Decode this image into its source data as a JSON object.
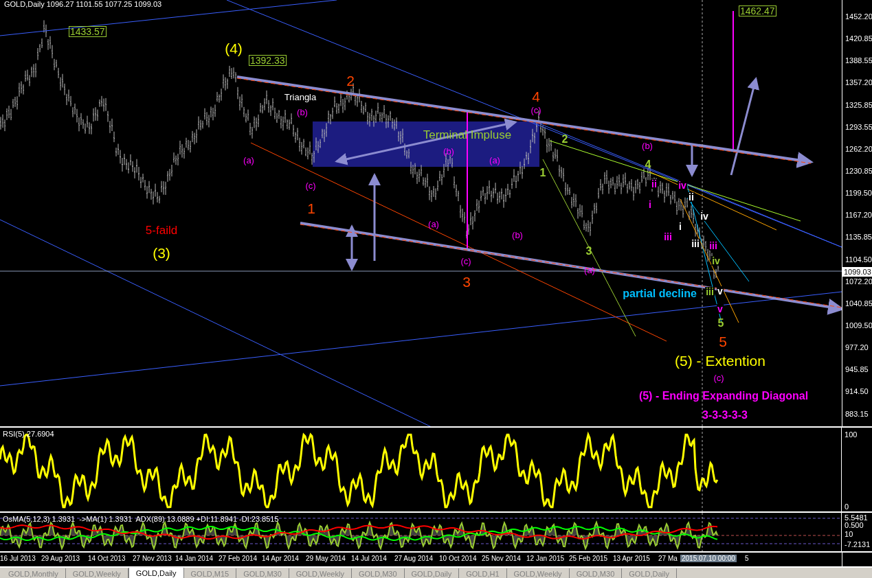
{
  "chart": {
    "header": "GOLD,Daily  1096.27 1101.55 1077.25 1099.03",
    "annotations": [
      {
        "kind": "price_box",
        "text": "1433.57",
        "color": "#9acd32"
      },
      {
        "kind": "price_box",
        "text": "1392.33",
        "color": "#9acd32"
      },
      {
        "kind": "price_box",
        "text": "1462.47",
        "color": "#9acd32"
      },
      {
        "kind": "big",
        "text": "(4)",
        "color": "#ffff00"
      },
      {
        "kind": "small",
        "text": "Triangla",
        "color": "#ffffff"
      },
      {
        "kind": "big",
        "text": "2",
        "color": "#ff4500"
      },
      {
        "kind": "big",
        "text": "4",
        "color": "#ff4500"
      },
      {
        "kind": "small",
        "text": "(c)",
        "color": "#ff00ff"
      },
      {
        "kind": "small",
        "text": "(b)",
        "color": "#ff00ff"
      },
      {
        "kind": "small",
        "text": "(a)",
        "color": "#ff00ff"
      },
      {
        "kind": "small",
        "text": "(c)",
        "color": "#ff00ff"
      },
      {
        "kind": "medium",
        "text": "Terminal Impluse",
        "color": "#9acd32"
      },
      {
        "kind": "small",
        "text": "(b)",
        "color": "#ff00ff"
      },
      {
        "kind": "small",
        "text": "(a)",
        "color": "#ff00ff"
      },
      {
        "kind": "bold",
        "text": "2",
        "color": "#9acd32"
      },
      {
        "kind": "bold",
        "text": "1",
        "color": "#9acd32"
      },
      {
        "kind": "small",
        "text": "(b)",
        "color": "#ff00ff"
      },
      {
        "kind": "bold",
        "text": "4",
        "color": "#9acd32"
      },
      {
        "kind": "tiny",
        "text": "ii",
        "color": "#ff00ff"
      },
      {
        "kind": "tiny",
        "text": "iv",
        "color": "#ff00ff"
      },
      {
        "kind": "tiny",
        "text": "ii",
        "color": "#ffffff"
      },
      {
        "kind": "tiny",
        "text": "i",
        "color": "#ff00ff"
      },
      {
        "kind": "tiny",
        "text": "i",
        "color": "#ffffff"
      },
      {
        "kind": "tiny",
        "text": "iii",
        "color": "#ff00ff"
      },
      {
        "kind": "tiny",
        "text": "iv",
        "color": "#ffffff"
      },
      {
        "kind": "tiny",
        "text": "iii",
        "color": "#ffffff"
      },
      {
        "kind": "tiny",
        "text": "iii",
        "color": "#ff00ff"
      },
      {
        "kind": "tiny",
        "text": "iv",
        "color": "#9acd32"
      },
      {
        "kind": "tiny",
        "text": "iii",
        "color": "#9acd32"
      },
      {
        "kind": "tiny",
        "text": "v",
        "color": "#ffffff"
      },
      {
        "kind": "tiny",
        "text": "v",
        "color": "#ff00ff"
      },
      {
        "kind": "medium",
        "text": "5-faild",
        "color": "#ff0000"
      },
      {
        "kind": "big",
        "text": "(3)",
        "color": "#ffff00"
      },
      {
        "kind": "big",
        "text": "1",
        "color": "#ff4500"
      },
      {
        "kind": "small",
        "text": "(a)",
        "color": "#ff00ff"
      },
      {
        "kind": "small",
        "text": "(b)",
        "color": "#ff00ff"
      },
      {
        "kind": "small",
        "text": "(c)",
        "color": "#ff00ff"
      },
      {
        "kind": "big",
        "text": "3",
        "color": "#ff4500"
      },
      {
        "kind": "bold",
        "text": "3",
        "color": "#9acd32"
      },
      {
        "kind": "small",
        "text": "(a)",
        "color": "#ff00ff"
      },
      {
        "kind": "bold",
        "text": "partial decline",
        "color": "#00bfff"
      },
      {
        "kind": "bold",
        "text": "5",
        "color": "#9acd32"
      },
      {
        "kind": "big",
        "text": "5",
        "color": "#ff4500"
      },
      {
        "kind": "big",
        "text": "(5) -  Extention",
        "color": "#ffff00"
      },
      {
        "kind": "small",
        "text": "(c)",
        "color": "#ff00ff"
      },
      {
        "kind": "bold",
        "text": "(5) - Ending Expanding Diagonal",
        "color": "#ff00ff"
      },
      {
        "kind": "bold",
        "text": "3-3-3-3-3",
        "color": "#ff00ff"
      }
    ],
    "price_axis": [
      "1452.20",
      "1420.85",
      "1388.55",
      "1357.20",
      "1325.85",
      "1293.55",
      "1262.20",
      "1230.85",
      "1199.50",
      "1167.20",
      "1135.85",
      "1104.50",
      "1072.20",
      "1040.85",
      "1009.50",
      "977.20",
      "945.85",
      "914.50",
      "883.15"
    ],
    "current_price": "1099.03"
  },
  "rsi_panel": {
    "caption": "RSI(5) 27.6904",
    "axis": [
      "100",
      "0"
    ]
  },
  "osma_panel": {
    "caption": "OsMA(5,12,3) 1.3931  ->MA(1) 1.3931  ADX(89) 13.0889 +DI:11.8941 -DI:23.8515",
    "axis": [
      "5.5481",
      "0.500",
      "10",
      "-7.2131"
    ]
  },
  "time_axis": {
    "labels": [
      "16 Jul 2013",
      "29 Aug 2013",
      "14 Oct 2013",
      "27 Nov 2013",
      "14 Jan 2014",
      "27 Feb 2014",
      "14 Apr 2014",
      "29 May 2014",
      "14 Jul 2014",
      "27 Aug 2014",
      "10 Oct 2014",
      "25 Nov 2014",
      "12 Jan 2015",
      "25 Feb 2015",
      "13 Apr 2015",
      "27 Ma",
      "5"
    ],
    "crosshair_time": "2015.07.10 00:00"
  },
  "tabs": [
    {
      "label": "GOLD,Monthly",
      "selected": false
    },
    {
      "label": "GOLD,Weekly",
      "selected": false
    },
    {
      "label": "GOLD,Daily",
      "selected": true
    },
    {
      "label": "GOLD,M15",
      "selected": false
    },
    {
      "label": "GOLD,M30",
      "selected": false
    },
    {
      "label": "GOLD,Weekly",
      "selected": false
    },
    {
      "label": "GOLD,M30",
      "selected": false
    },
    {
      "label": "GOLD,Daily",
      "selected": false
    },
    {
      "label": "GOLD,H1",
      "selected": false
    },
    {
      "label": "GOLD,Weekly",
      "selected": false
    },
    {
      "label": "GOLD,M30",
      "selected": false
    },
    {
      "label": "GOLD,Daily",
      "selected": false
    }
  ]
}
